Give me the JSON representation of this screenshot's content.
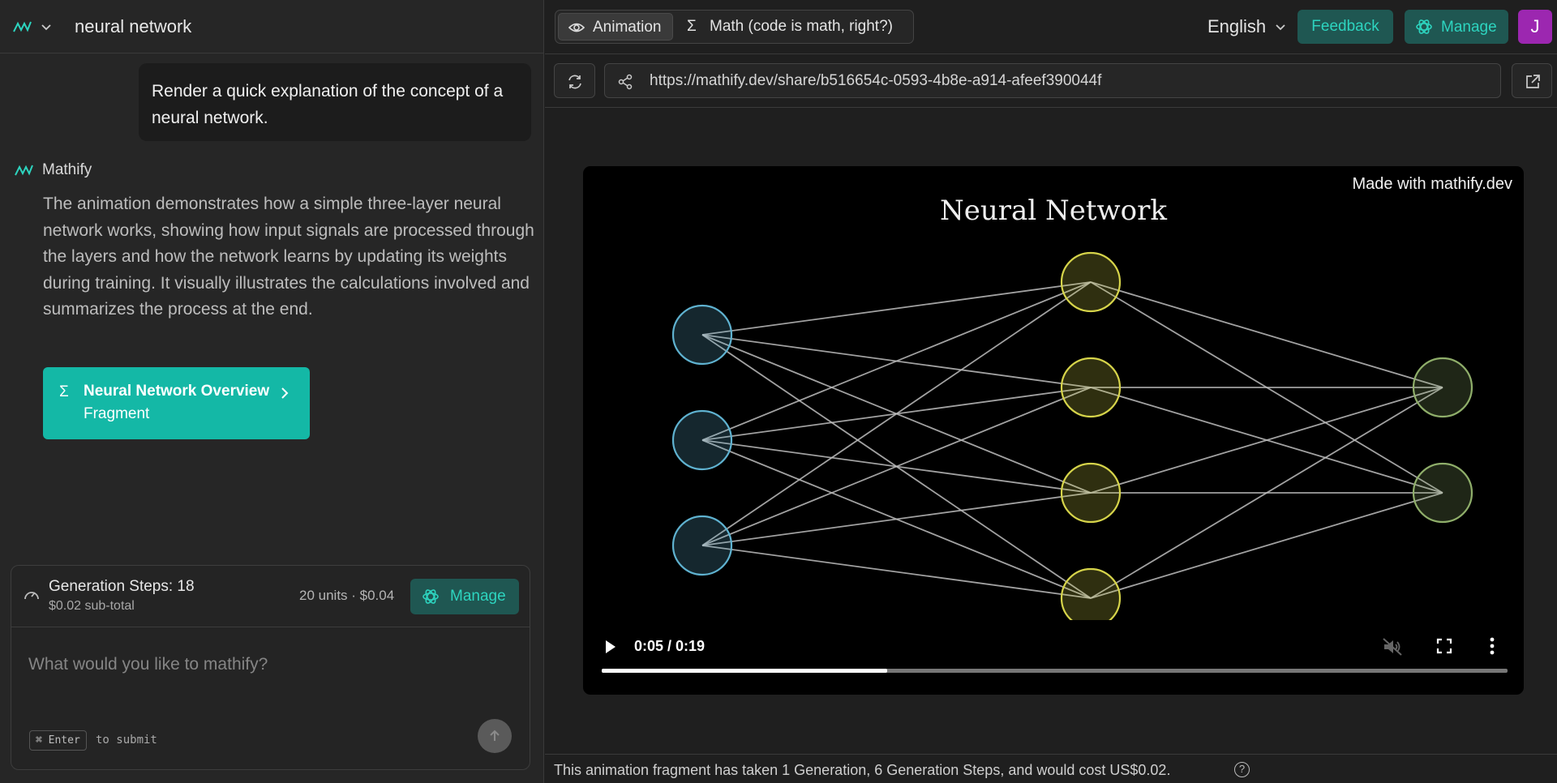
{
  "header": {
    "conversation_title": "neural network"
  },
  "chat": {
    "user_message": "Render a quick explanation of the concept of a neural network.",
    "bot_name": "Mathify",
    "bot_message": "The animation demonstrates how a simple three-layer neural network works, showing how input signals are processed through the layers and how the network learns by updating its weights during training. It visually illustrates the calculations involved and summarizes the process at the end.",
    "fragment": {
      "title": "Neural Network Overview",
      "subtitle": "Fragment"
    }
  },
  "composer": {
    "gen_steps": "Generation Steps: 18",
    "subtotal": "$0.02 sub-total",
    "cost": "20 units · $0.04",
    "manage_label": "Manage",
    "placeholder": "What would you like to mathify?",
    "kbd": "⌘ Enter",
    "kbd_hint": "to submit"
  },
  "topbar": {
    "tabs": [
      {
        "label": "Animation",
        "icon": "eye-icon",
        "active": true
      },
      {
        "label": "Math (code is math, right?)",
        "icon": "sigma-icon",
        "active": false
      }
    ],
    "language": "English",
    "feedback_label": "Feedback",
    "manage_label": "Manage",
    "avatar_letter": "J"
  },
  "urlbar": {
    "url": "https://mathify.dev/share/b516654c-0593-4b8e-a914-afeef390044f"
  },
  "video": {
    "watermark": "Made with mathify.dev",
    "title": "Neural Network",
    "time": "0:05 / 0:19",
    "progress": 0.315,
    "layers": [
      {
        "nodes": 3,
        "color": "#5fb2d0"
      },
      {
        "nodes": 4,
        "color": "#d6d44a"
      },
      {
        "nodes": 2,
        "color": "#8fae6a"
      }
    ]
  },
  "footer": {
    "text": "This animation fragment has taken 1 Generation, 6 Generation Steps, and would cost US$0.02.",
    "help": "?"
  },
  "colors": {
    "accent": "#14b8a6",
    "accent_text": "#2dd4bf",
    "accent_dark": "#1f5752",
    "avatar": "#9c27b0"
  }
}
